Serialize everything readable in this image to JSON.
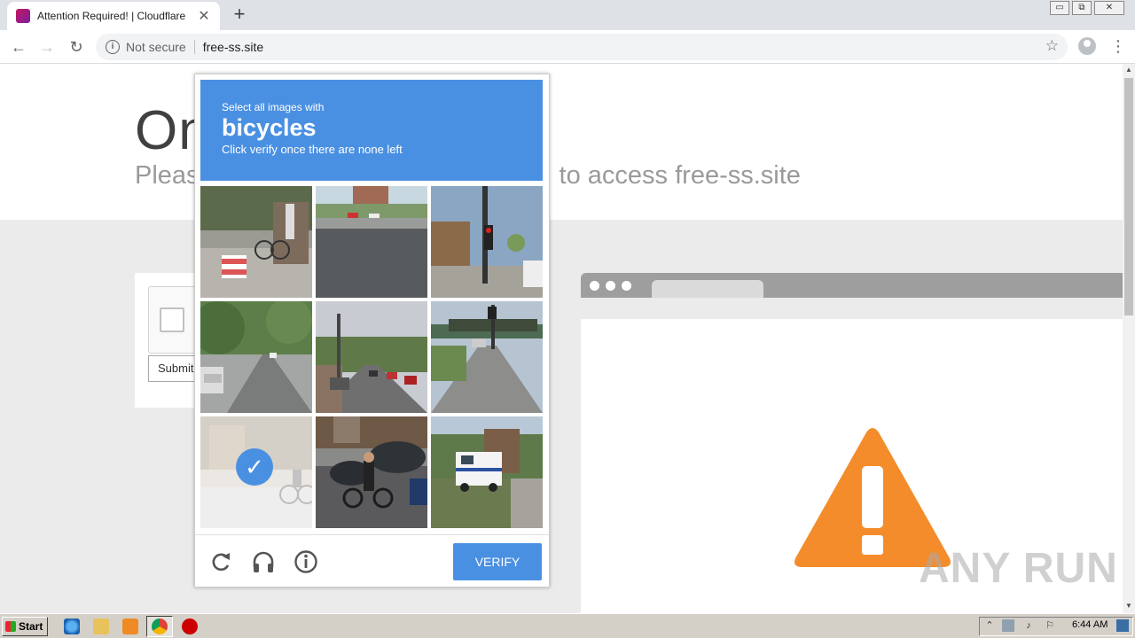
{
  "browser": {
    "tab_title": "Attention Required! | Cloudflare",
    "tab_close": "✕",
    "new_tab": "+",
    "security_label": "Not secure",
    "url": "free-ss.site",
    "window_buttons": [
      "▭",
      "⧉",
      "✕"
    ]
  },
  "page": {
    "heading": "On",
    "subline_start": "Pleas",
    "subline_end": "to access free-ss.site",
    "submit_label": "Submit"
  },
  "captcha": {
    "instruction": "Select all images with",
    "target": "bicycles",
    "hint": "Click verify once there are none left",
    "verify_label": "VERIFY",
    "tiles": [
      {
        "name": "tile-1",
        "selected": false
      },
      {
        "name": "tile-2",
        "selected": false
      },
      {
        "name": "tile-3",
        "selected": false
      },
      {
        "name": "tile-4",
        "selected": false
      },
      {
        "name": "tile-5",
        "selected": false
      },
      {
        "name": "tile-6",
        "selected": false
      },
      {
        "name": "tile-7",
        "selected": true
      },
      {
        "name": "tile-8",
        "selected": false
      },
      {
        "name": "tile-9",
        "selected": false
      }
    ],
    "check": "✓"
  },
  "watermark": "ANY RUN",
  "taskbar": {
    "start_label": "Start",
    "clock": "6:44 AM"
  },
  "colors": {
    "captcha_blue": "#4a90e2",
    "warning_orange": "#f48c2b"
  },
  "icons": [
    "info-icon",
    "star-icon",
    "reload-icon",
    "audio-icon",
    "help-icon",
    "warning-icon"
  ]
}
